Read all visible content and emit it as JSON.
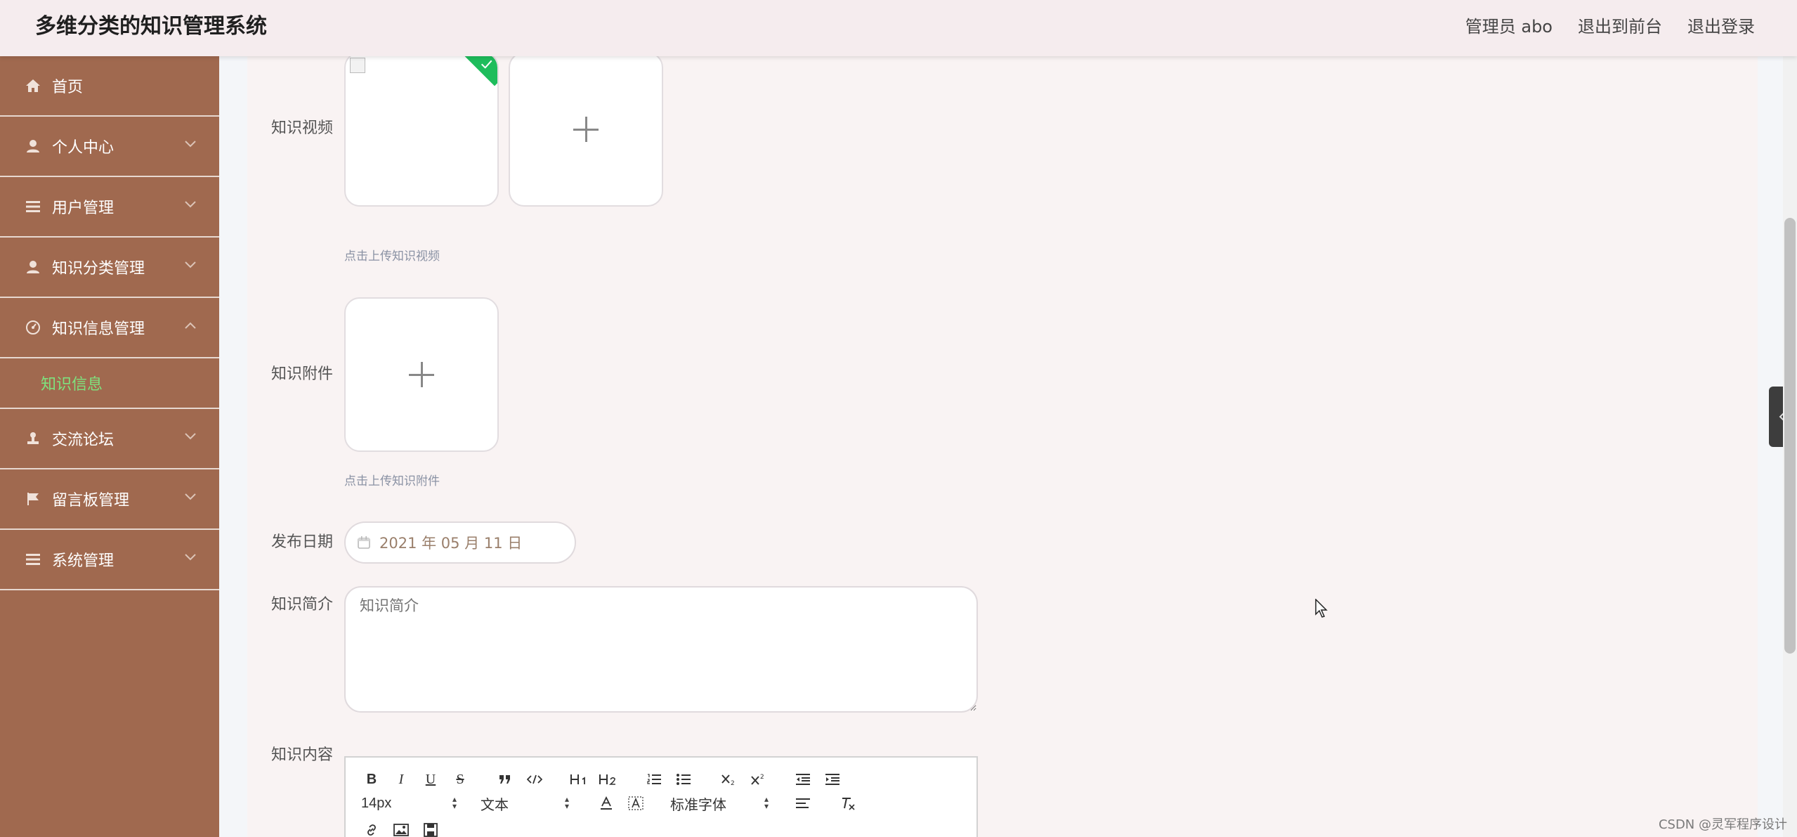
{
  "header": {
    "title": "多维分类的知识管理系统",
    "links": [
      "管理员 abo",
      "退出到前台",
      "退出登录"
    ]
  },
  "sidebar": {
    "items": [
      {
        "label": "首页",
        "icon": "home-icon"
      },
      {
        "label": "个人中心",
        "icon": "user-icon"
      },
      {
        "label": "用户管理",
        "icon": "list-icon"
      },
      {
        "label": "知识分类管理",
        "icon": "user-icon"
      },
      {
        "label": "知识信息管理",
        "icon": "dashboard-icon",
        "expanded": true,
        "children": [
          "知识信息"
        ]
      },
      {
        "label": "交流论坛",
        "icon": "stamp-icon"
      },
      {
        "label": "留言板管理",
        "icon": "flag-icon"
      },
      {
        "label": "系统管理",
        "icon": "list-icon"
      }
    ]
  },
  "form": {
    "video_label": "知识视频",
    "video_tip": "点击上传知识视频",
    "attachment_label": "知识附件",
    "attachment_tip": "点击上传知识附件",
    "date_label": "发布日期",
    "date_value": "2021 年 05 月 11 日",
    "intro_label": "知识简介",
    "intro_placeholder": "知识简介",
    "content_label": "知识内容"
  },
  "editor": {
    "font_size": "14px",
    "block_format": "文本",
    "font_family": "标准字体",
    "tools_row1": [
      "B",
      "I",
      "U",
      "S"
    ]
  },
  "watermark": "CSDN @灵军程序设计",
  "colors": {
    "sidebar_bg": "#a0694f",
    "active_submenu": "#7ee27e",
    "header_bg": "#f5ecee",
    "success_badge": "#1ebd5c"
  }
}
